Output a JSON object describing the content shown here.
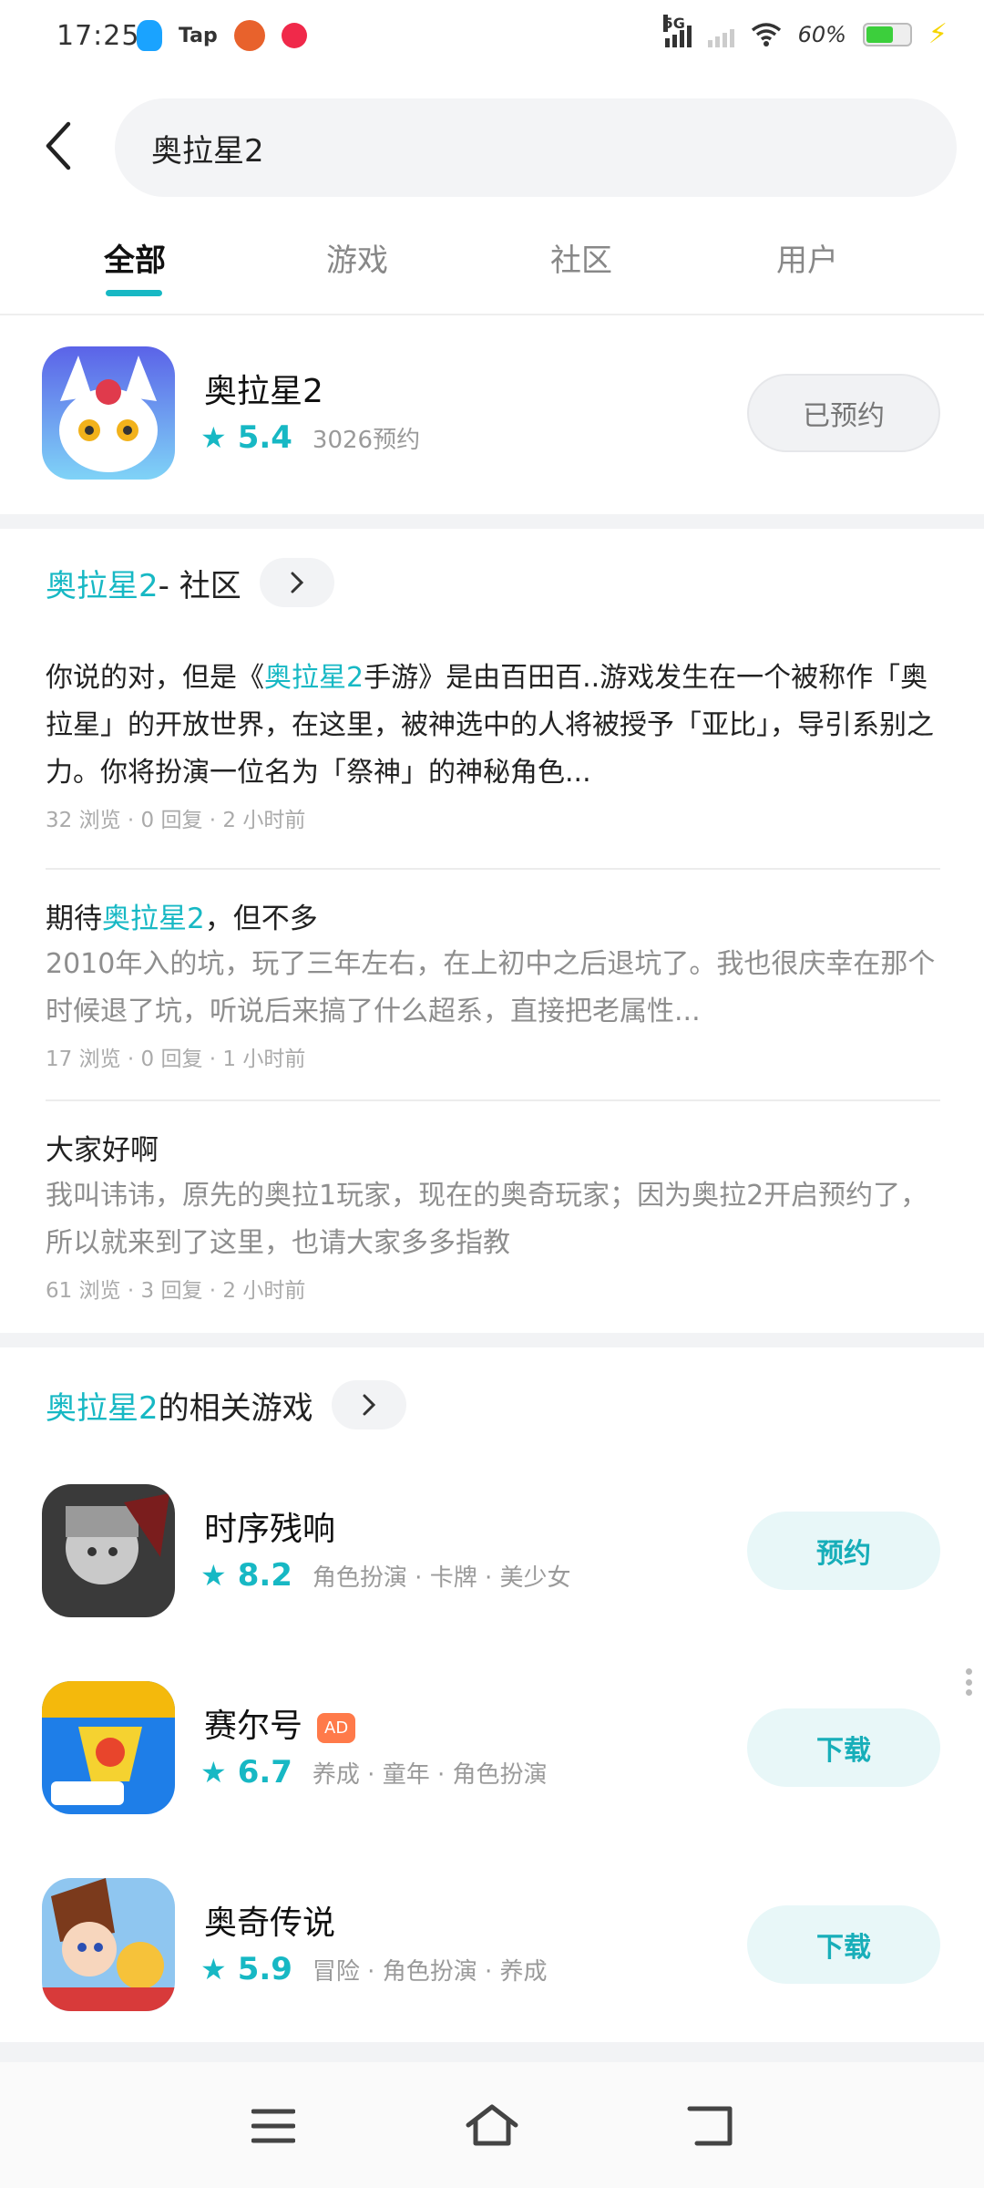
{
  "status_bar": {
    "time": "17:25",
    "tap_label": "Tap",
    "network": "5G",
    "battery": "60%"
  },
  "search": {
    "query": "奥拉星2"
  },
  "tabs": [
    {
      "label": "全部",
      "active": true
    },
    {
      "label": "游戏",
      "active": false
    },
    {
      "label": "社区",
      "active": false
    },
    {
      "label": "用户",
      "active": false
    }
  ],
  "top_app": {
    "name": "奥拉星2",
    "rating": "5.4",
    "reservations": "3026预约",
    "action": "已预约"
  },
  "community": {
    "title_highlight": "奥拉星2",
    "title_rest": " - 社区",
    "posts": [
      {
        "title": "",
        "body_prefix": "你说的对，但是《",
        "body_highlight": "奥拉星2",
        "body_suffix": "手游》是由百田百..游戏发生在一个被称作「奥拉星」的开放世界，在这里，被神选中的人将被授予「亚比」，导引系别之力。你将扮演一位名为「祭神」的神秘角色...",
        "stats": "32 浏览 · 0 回复 · 2 小时前"
      },
      {
        "title_prefix": "期待",
        "title_highlight": "奥拉星2",
        "title_suffix": "，但不多",
        "body": "2010年入的坑，玩了三年左右，在上初中之后退坑了。我也很庆幸在那个时候退了坑，听说后来搞了什么超系，直接把老属性...",
        "stats": "17 浏览 · 0 回复 · 1 小时前"
      },
      {
        "title": "大家好啊",
        "body": "我叫讳讳，原先的奥拉1玩家，现在的奥奇玩家；因为奥拉2开启预约了，所以就来到了这里，也请大家多多指教",
        "stats": "61 浏览 · 3 回复 · 2 小时前"
      }
    ]
  },
  "related": {
    "title_highlight": "奥拉星2",
    "title_rest": "的相关游戏",
    "games": [
      {
        "name": "时序残响",
        "rating": "8.2",
        "tags": "角色扮演 · 卡牌 · 美少女",
        "action": "预约",
        "ad": ""
      },
      {
        "name": "赛尔号",
        "rating": "6.7",
        "tags": "养成 · 童年 · 角色扮演",
        "action": "下载",
        "ad": "AD"
      },
      {
        "name": "奥奇传说",
        "rating": "5.9",
        "tags": "冒险 · 角色扮演 · 养成",
        "action": "下载",
        "ad": ""
      }
    ]
  },
  "colors": {
    "accent": "#17b8c4",
    "ad": "#ff7a4a"
  },
  "icons": {
    "back": "chevron-left-icon",
    "chevron": "chevron-right-icon",
    "star": "star-icon",
    "menu": "menu-icon",
    "home": "home-icon",
    "return": "return-icon"
  }
}
